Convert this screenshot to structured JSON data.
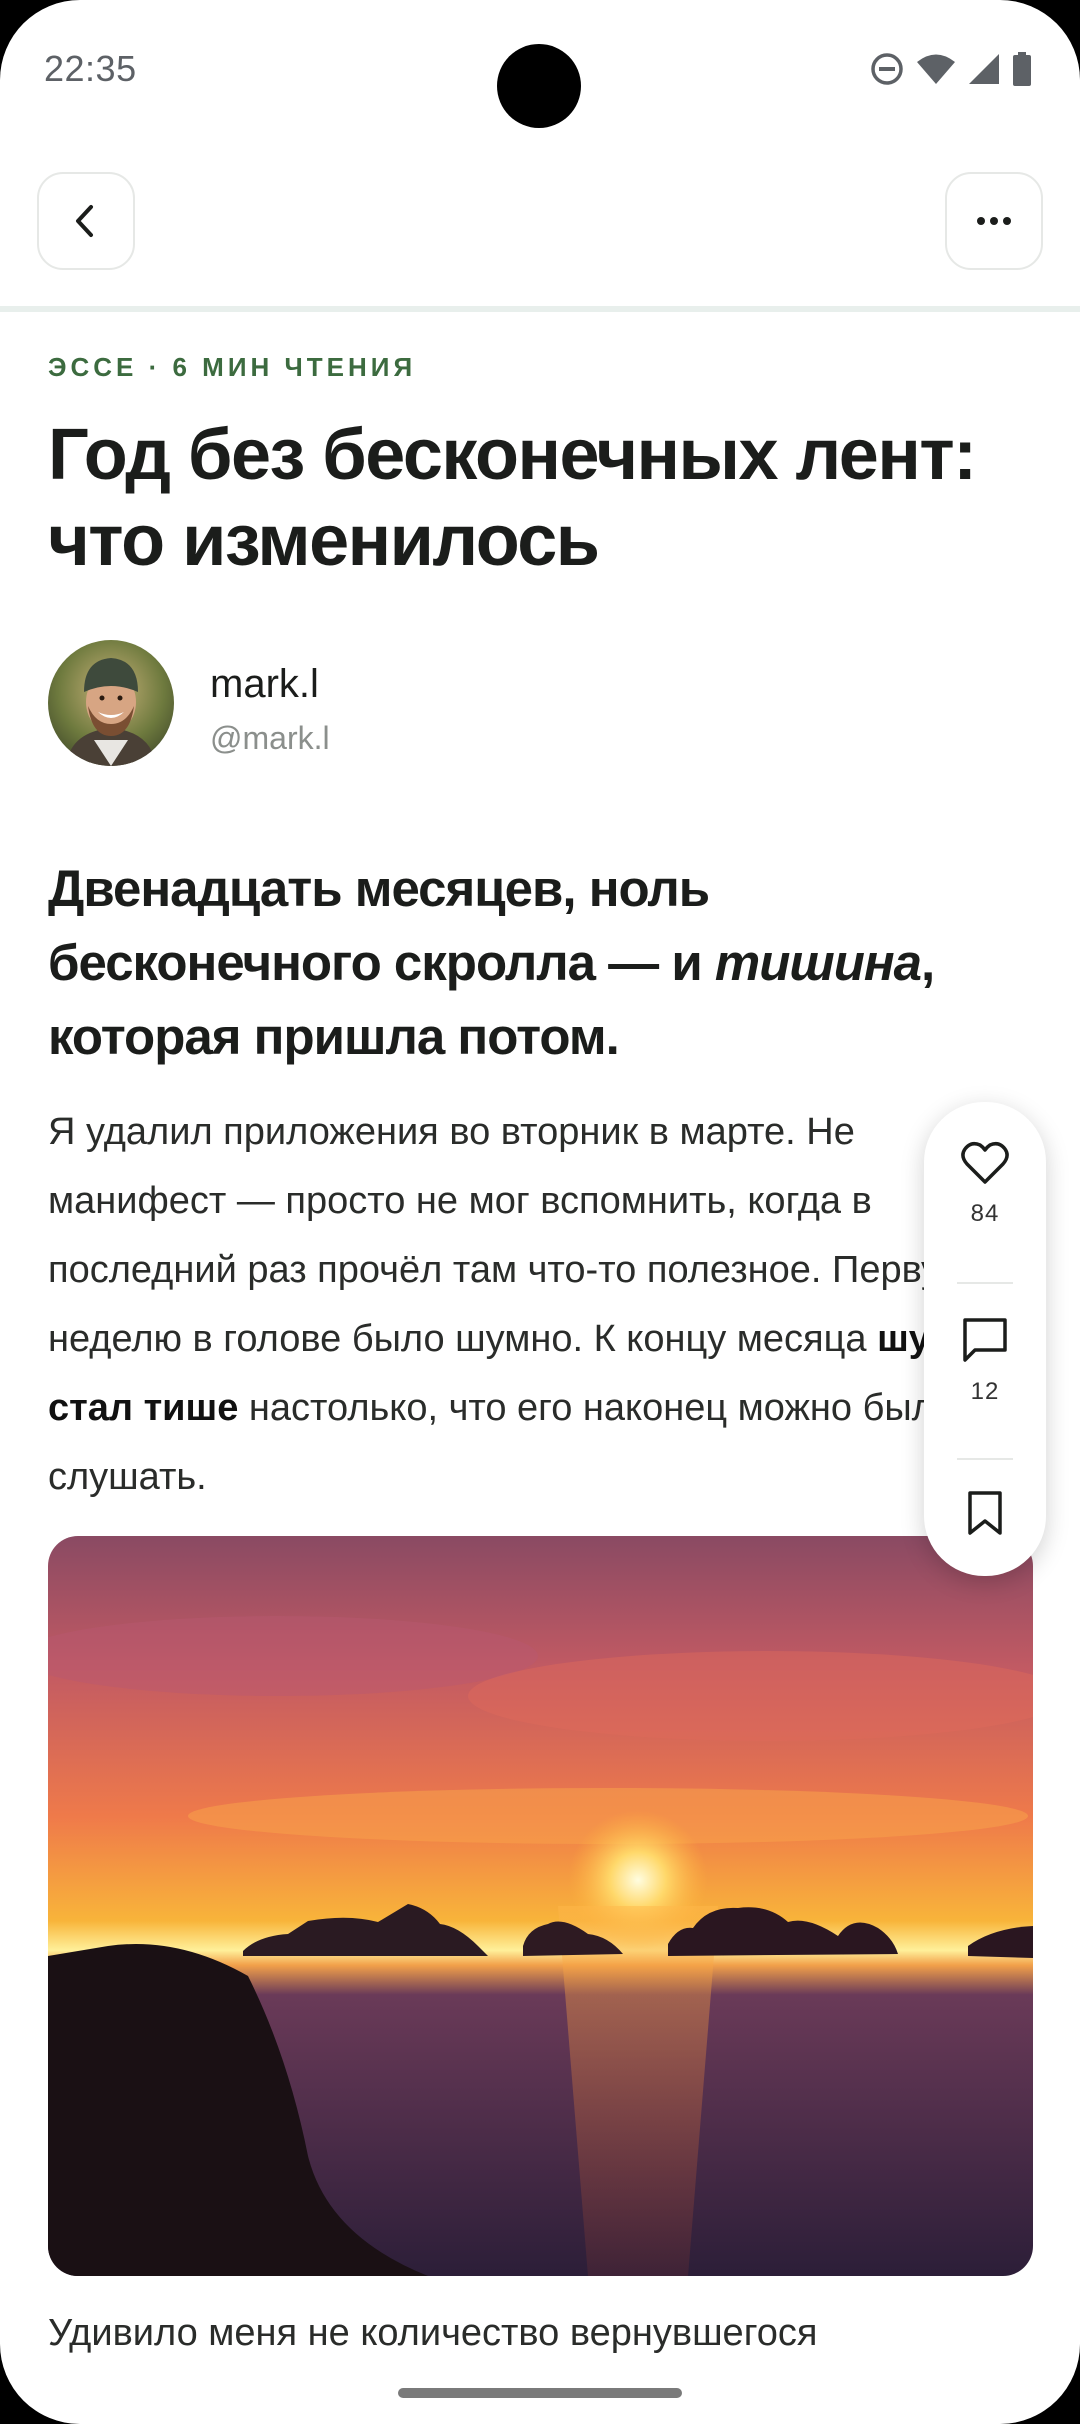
{
  "status": {
    "time": "22:35"
  },
  "header": {
    "back_icon": "chevron-left-icon",
    "more_icon": "more-horizontal-icon"
  },
  "article": {
    "kicker": "ЭССЕ · 6 МИН ЧТЕНИЯ",
    "title": "Год без бесконечных лент: что изменилось",
    "author_name": "mark.l",
    "author_handle": "@mark.l",
    "lede_part1": "Двенадцать месяцев, ноль бесконечного скролла — и ",
    "lede_em": "тишина",
    "lede_part2": ", которая пришла потом.",
    "body_part1": "Я удалил приложения во вторник в марте. Не манифест — просто не мог вспомнить, когда в последний раз прочёл там что-то полезное. Первую неделю в голове было шумно. К концу месяца ",
    "body_bold": "шум стал тише",
    "body_part2": " настолько, что его наконец можно было слушать.",
    "next_paragraph": "Удивило меня не количество вернувшегося"
  },
  "actions": {
    "likes": "84",
    "comments": "12"
  },
  "colors": {
    "accent": "#3c6b3f",
    "text": "#1b1d1b",
    "divider": "#e8efec"
  }
}
